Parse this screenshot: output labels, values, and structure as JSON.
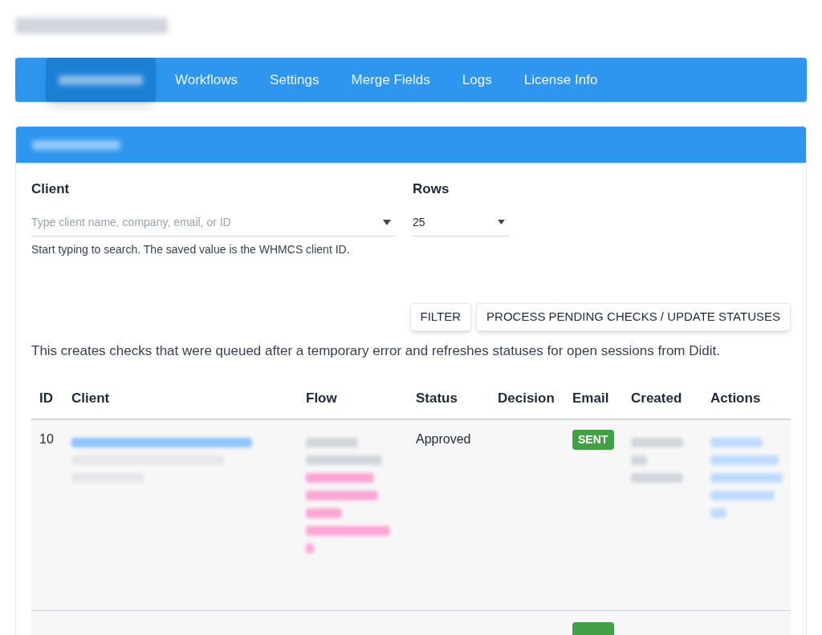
{
  "tabs": [
    {
      "selected": true
    },
    {
      "label": "Workflows",
      "selected": false
    },
    {
      "label": "Settings",
      "selected": false
    },
    {
      "label": "Merge Fields",
      "selected": false
    },
    {
      "label": "Logs",
      "selected": false
    },
    {
      "label": "License Info",
      "selected": false
    }
  ],
  "filters": {
    "client": {
      "label": "Client",
      "placeholder": "Type client name, company, email, or ID",
      "help": "Start typing to search. The saved value is the WHMCS client ID."
    },
    "rows": {
      "label": "Rows",
      "value": "25"
    }
  },
  "buttons": [
    "FILTER",
    "PROCESS PENDING CHECKS / UPDATE STATUSES"
  ],
  "note": "This creates checks that were queued after a temporary error and refreshes statuses for open sessions from Didit.",
  "table": {
    "columns": [
      "ID",
      "Client",
      "Flow",
      "Status",
      "Decision",
      "Email",
      "Created",
      "Actions"
    ],
    "rows": [
      {
        "id": "10",
        "status": "Approved",
        "email": "SENT",
        "email_sent": true
      },
      {
        "email_sent": true
      }
    ]
  }
}
